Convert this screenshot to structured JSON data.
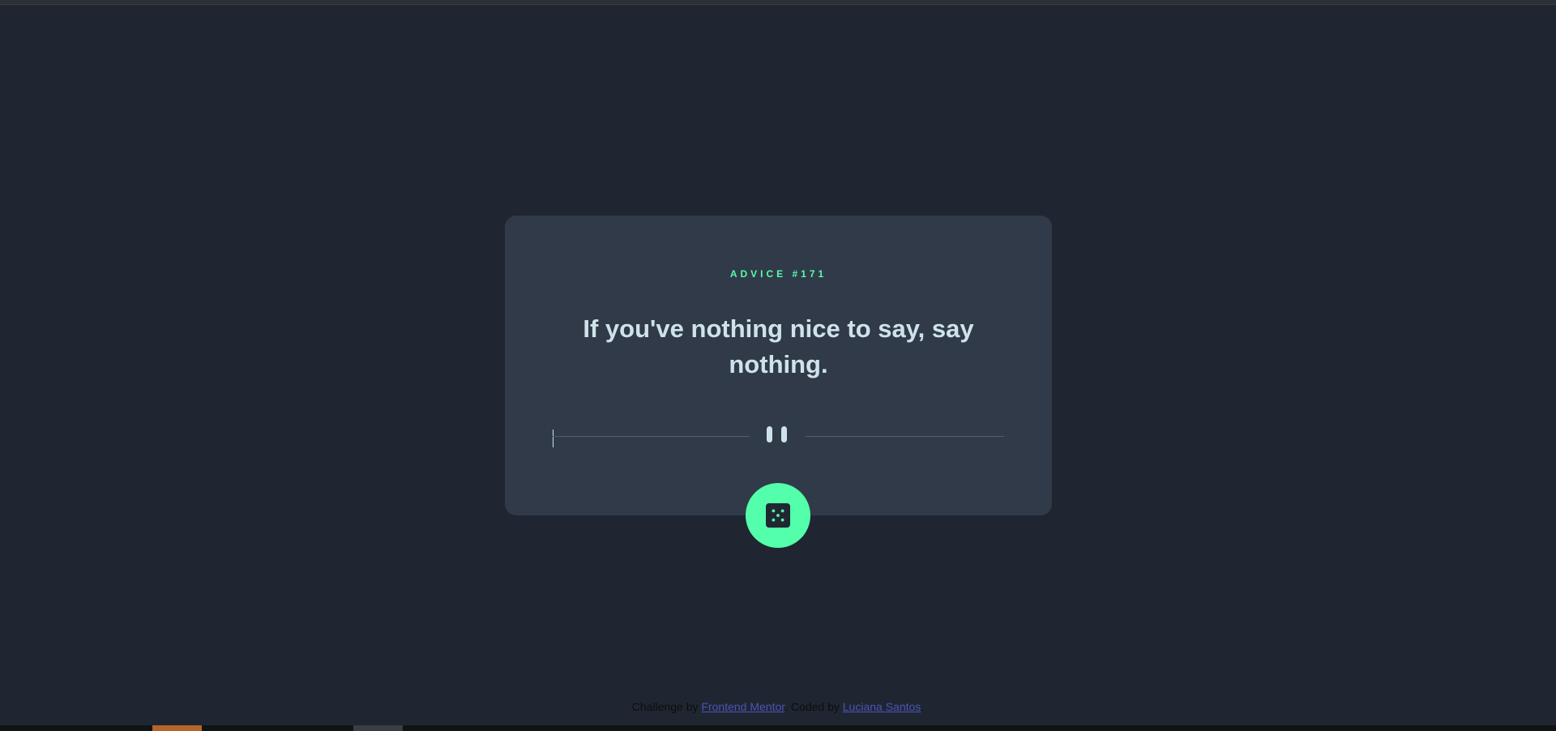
{
  "card": {
    "advice_label": "ADVICE #171",
    "quote": "If you've nothing nice to say, say nothing."
  },
  "button": {
    "icon": "dice-icon"
  },
  "divider": {
    "icon": "pause-icon"
  },
  "footer": {
    "prefix": "Challenge by ",
    "link1": "Frontend Mentor",
    "middle": ". Coded by ",
    "link2": "Luciana Santos",
    "suffix": "."
  },
  "colors": {
    "background": "#1f2631",
    "card": "#313a48",
    "accent": "#53ffaa",
    "text": "#cee3e9",
    "divider": "#4f5d74"
  }
}
